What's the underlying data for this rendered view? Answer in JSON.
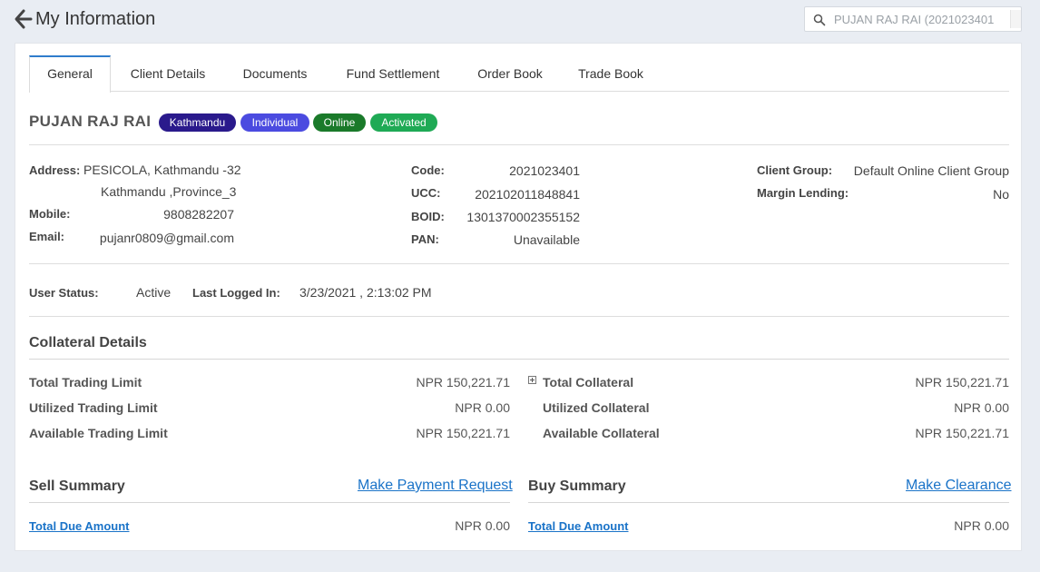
{
  "header": {
    "title": "My Information",
    "search_placeholder": "PUJAN RAJ RAI (2021023401"
  },
  "tabs": [
    {
      "label": "General",
      "active": true
    },
    {
      "label": "Client Details"
    },
    {
      "label": "Documents"
    },
    {
      "label": "Fund Settlement"
    },
    {
      "label": "Order Book"
    },
    {
      "label": "Trade Book"
    }
  ],
  "client": {
    "name": "PUJAN RAJ RAI",
    "badges": [
      {
        "label": "Kathmandu",
        "color": "#2a1a8c"
      },
      {
        "label": "Individual",
        "color": "#4b4be0"
      },
      {
        "label": "Online",
        "color": "#1a7a2a"
      },
      {
        "label": "Activated",
        "color": "#1faa55"
      }
    ]
  },
  "details": {
    "address_label": "Address:",
    "address_line1": "PESICOLA, Kathmandu -32",
    "address_line2": "Kathmandu ,Province_3",
    "mobile_label": "Mobile:",
    "mobile": "9808282207",
    "email_label": "Email:",
    "email": "pujanr0809@gmail.com",
    "code_label": "Code:",
    "code": "2021023401",
    "ucc_label": "UCC:",
    "ucc": "202102011848841",
    "boid_label": "BOID:",
    "boid": "1301370002355152",
    "pan_label": "PAN:",
    "pan": "Unavailable",
    "client_group_label": "Client Group:",
    "client_group": "Default Online Client Group",
    "margin_lending_label": "Margin Lending:",
    "margin_lending": "No"
  },
  "status": {
    "user_status_label": "User Status:",
    "user_status": "Active",
    "last_logged_label": "Last Logged In:",
    "last_logged": "3/23/2021 , 2:13:02 PM"
  },
  "collateral": {
    "title": "Collateral Details",
    "total_trading_limit_label": "Total Trading Limit",
    "total_trading_limit": "NPR 150,221.71",
    "utilized_trading_limit_label": "Utilized Trading Limit",
    "utilized_trading_limit": "NPR 0.00",
    "available_trading_limit_label": "Available Trading Limit",
    "available_trading_limit": "NPR 150,221.71",
    "total_collateral_label": "Total Collateral",
    "total_collateral": "NPR 150,221.71",
    "utilized_collateral_label": "Utilized Collateral",
    "utilized_collateral": "NPR 0.00",
    "available_collateral_label": "Available Collateral",
    "available_collateral": "NPR 150,221.71"
  },
  "sell_summary": {
    "title": "Sell Summary",
    "action": "Make Payment Request",
    "due_label": "Total Due Amount",
    "due": "NPR 0.00"
  },
  "buy_summary": {
    "title": "Buy Summary",
    "action": "Make Clearance",
    "due_label": "Total Due Amount",
    "due": "NPR 0.00"
  }
}
